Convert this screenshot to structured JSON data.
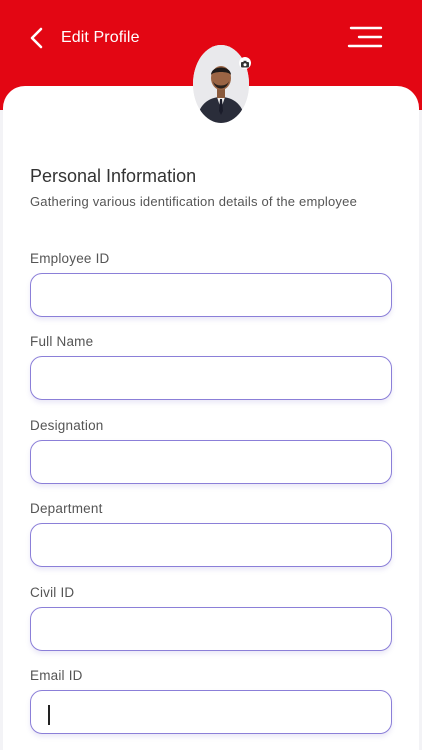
{
  "header": {
    "title": "Edit Profile",
    "back_icon": "chevron-left-icon",
    "menu_icon": "hamburger-menu-icon",
    "color": "#e30613"
  },
  "profile": {
    "camera_icon": "camera-icon"
  },
  "section": {
    "title": "Personal Information",
    "subtitle": "Gathering various identification details of the employee"
  },
  "fields": [
    {
      "label": "Employee ID",
      "value": ""
    },
    {
      "label": "Full Name",
      "value": ""
    },
    {
      "label": "Designation",
      "value": ""
    },
    {
      "label": "Department",
      "value": ""
    },
    {
      "label": "Civil ID",
      "value": ""
    },
    {
      "label": "Email ID",
      "value": ""
    }
  ],
  "colors": {
    "input_border": "#8b7fd8",
    "background": "#f3f3f6"
  }
}
